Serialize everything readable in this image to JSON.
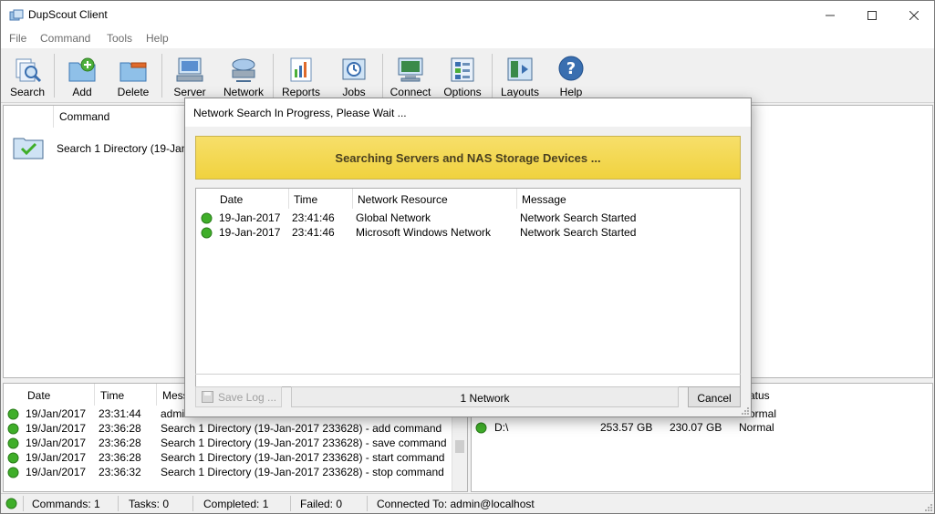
{
  "window": {
    "title": "DupScout Client"
  },
  "menu": [
    "File",
    "Command",
    "Tools",
    "Help"
  ],
  "toolbar": [
    {
      "label": "Search",
      "icon": "search-icon"
    },
    {
      "label": "Add",
      "icon": "add-folder-icon"
    },
    {
      "label": "Delete",
      "icon": "delete-folder-icon"
    },
    {
      "label": "Server",
      "icon": "server-icon"
    },
    {
      "label": "Network",
      "icon": "network-icon"
    },
    {
      "label": "Reports",
      "icon": "reports-icon"
    },
    {
      "label": "Jobs",
      "icon": "jobs-icon"
    },
    {
      "label": "Connect",
      "icon": "connect-icon"
    },
    {
      "label": "Options",
      "icon": "options-icon"
    },
    {
      "label": "Layouts",
      "icon": "layouts-icon"
    },
    {
      "label": "Help",
      "icon": "help-icon"
    }
  ],
  "commands": {
    "header": "Command",
    "rows": [
      {
        "name": "Search 1 Directory (19-Jan-"
      }
    ]
  },
  "log": {
    "headers": [
      "Date",
      "Time",
      "Mess"
    ],
    "rows": [
      {
        "date": "19/Jan/2017",
        "time": "23:31:44",
        "message": "admi"
      },
      {
        "date": "19/Jan/2017",
        "time": "23:36:28",
        "message": "Search 1 Directory (19-Jan-2017 233628) - add command"
      },
      {
        "date": "19/Jan/2017",
        "time": "23:36:28",
        "message": "Search 1 Directory (19-Jan-2017 233628) - save command"
      },
      {
        "date": "19/Jan/2017",
        "time": "23:36:28",
        "message": "Search 1 Directory (19-Jan-2017 233628) - start command"
      },
      {
        "date": "19/Jan/2017",
        "time": "23:36:32",
        "message": "Search 1 Directory (19-Jan-2017 233628) - stop command"
      }
    ]
  },
  "drives": {
    "status_header": "atus",
    "rows": [
      {
        "name": "",
        "total": "",
        "free": "",
        "status": "ormal"
      },
      {
        "name": "D:\\",
        "total": "253.57 GB",
        "free": "230.07 GB",
        "status": "Normal"
      }
    ]
  },
  "statusbar": {
    "commands": "Commands: 1",
    "tasks": "Tasks: 0",
    "completed": "Completed: 1",
    "failed": "Failed: 0",
    "connected": "Connected To: admin@localhost"
  },
  "dialog": {
    "title": "Network Search In Progress, Please Wait ...",
    "banner": "Searching Servers and NAS Storage Devices ...",
    "headers": [
      "Date",
      "Time",
      "Network Resource",
      "Message"
    ],
    "rows": [
      {
        "date": "19-Jan-2017",
        "time": "23:41:46",
        "resource": "Global Network",
        "message": "Network Search Started"
      },
      {
        "date": "19-Jan-2017",
        "time": "23:41:46",
        "resource": "Microsoft Windows Network",
        "message": "Network Search Started"
      }
    ],
    "save_log": "Save Log ...",
    "network_count": "1 Network",
    "cancel": "Cancel"
  },
  "colors": {
    "ok": "#3fae29",
    "banner": "#f0d23e",
    "accent": "#2f6db5"
  }
}
